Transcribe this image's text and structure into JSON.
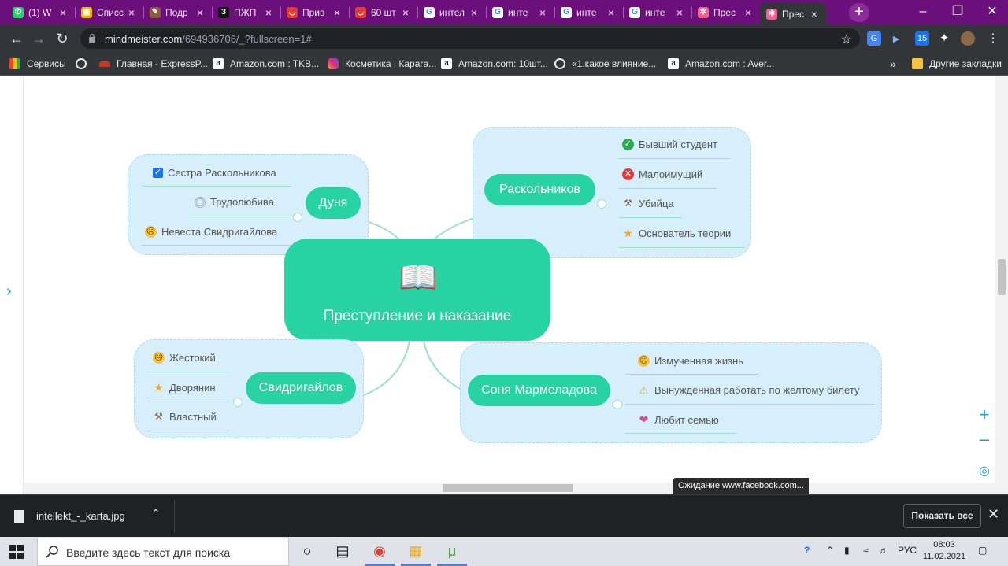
{
  "browser": {
    "tabs": [
      {
        "title": "(1) W",
        "favicon_color": "#25d366",
        "favicon_glyph": "✆"
      },
      {
        "title": "Списс",
        "favicon_color": "#f5b400",
        "favicon_glyph": "▣"
      },
      {
        "title": "Подр",
        "favicon_color": "#8a5a3c",
        "favicon_glyph": "✎"
      },
      {
        "title": "ПЖП",
        "favicon_color": "#111111",
        "favicon_glyph": "З"
      },
      {
        "title": "Прив",
        "favicon_color": "#e53935",
        "favicon_glyph": "◡"
      },
      {
        "title": "60 шт",
        "favicon_color": "#e53935",
        "favicon_glyph": "◡"
      },
      {
        "title": "интел",
        "favicon_color": "#ffffff",
        "favicon_glyph": "G"
      },
      {
        "title": "инте",
        "favicon_color": "#ffffff",
        "favicon_glyph": "G"
      },
      {
        "title": "инте",
        "favicon_color": "#ffffff",
        "favicon_glyph": "G"
      },
      {
        "title": "инте",
        "favicon_color": "#ffffff",
        "favicon_glyph": "G"
      },
      {
        "title": "Прес",
        "favicon_color": "#f06292",
        "favicon_glyph": "✲"
      },
      {
        "title": "Прес",
        "favicon_color": "#f06292",
        "favicon_glyph": "✲",
        "active": true
      }
    ],
    "url_host": "mindmeister.com",
    "url_path": "/694936706/_?fullscreen=1#",
    "bookmarks": [
      {
        "label": "Сервисы",
        "icon": "apps-grid-icon"
      },
      {
        "label": "",
        "icon": "globe-icon"
      },
      {
        "label": "Главная - ExpressP...",
        "icon": "expressp-icon"
      },
      {
        "label": "Amazon.com : TKB...",
        "icon": "amazon-icon"
      },
      {
        "label": "Косметика | Карага...",
        "icon": "instagram-icon"
      },
      {
        "label": "Amazon.com: 10шт...",
        "icon": "amazon-icon"
      },
      {
        "label": "«1.какое влияние...",
        "icon": "globe-icon"
      },
      {
        "label": "Amazon.com : Aver...",
        "icon": "amazon-icon"
      }
    ],
    "other_bookmarks": "Другие закладки",
    "more_bookmarks": "»"
  },
  "mindmap": {
    "center_title": "Преступление и  наказание",
    "center_icon": "📖",
    "branches": {
      "dunya": {
        "title": "Дуня",
        "leaves": [
          "Сестра Раскольникова",
          "Трудолюбива",
          "Невеста Свидригайлова"
        ]
      },
      "raskolnikov": {
        "title": "Раскольников",
        "leaves": [
          "Бывший студент",
          "Малоимущий",
          "Убийца",
          "Основатель теории"
        ]
      },
      "svidrigailov": {
        "title": "Свидригайлов",
        "leaves": [
          "Жестокий",
          "Дворянин",
          "Властный"
        ]
      },
      "sonya": {
        "title": "Соня Мармеладова",
        "leaves": [
          "Измученная жизнь",
          "Вынужденная работать по желтому билету",
          "Любит семью"
        ]
      }
    },
    "colors": {
      "topic": "#27d3a2",
      "cloud": "#d7effa",
      "connector": "#9fe0cc"
    }
  },
  "status_bubble": "Ожидание www.facebook.com...",
  "download_bar": {
    "filename": "intellekt_-_karta.jpg",
    "show_all": "Показать все"
  },
  "taskbar": {
    "search_placeholder": "Введите здесь текст для поиска",
    "language": "РУС",
    "time": "08:03",
    "date": "11.02.2021"
  }
}
